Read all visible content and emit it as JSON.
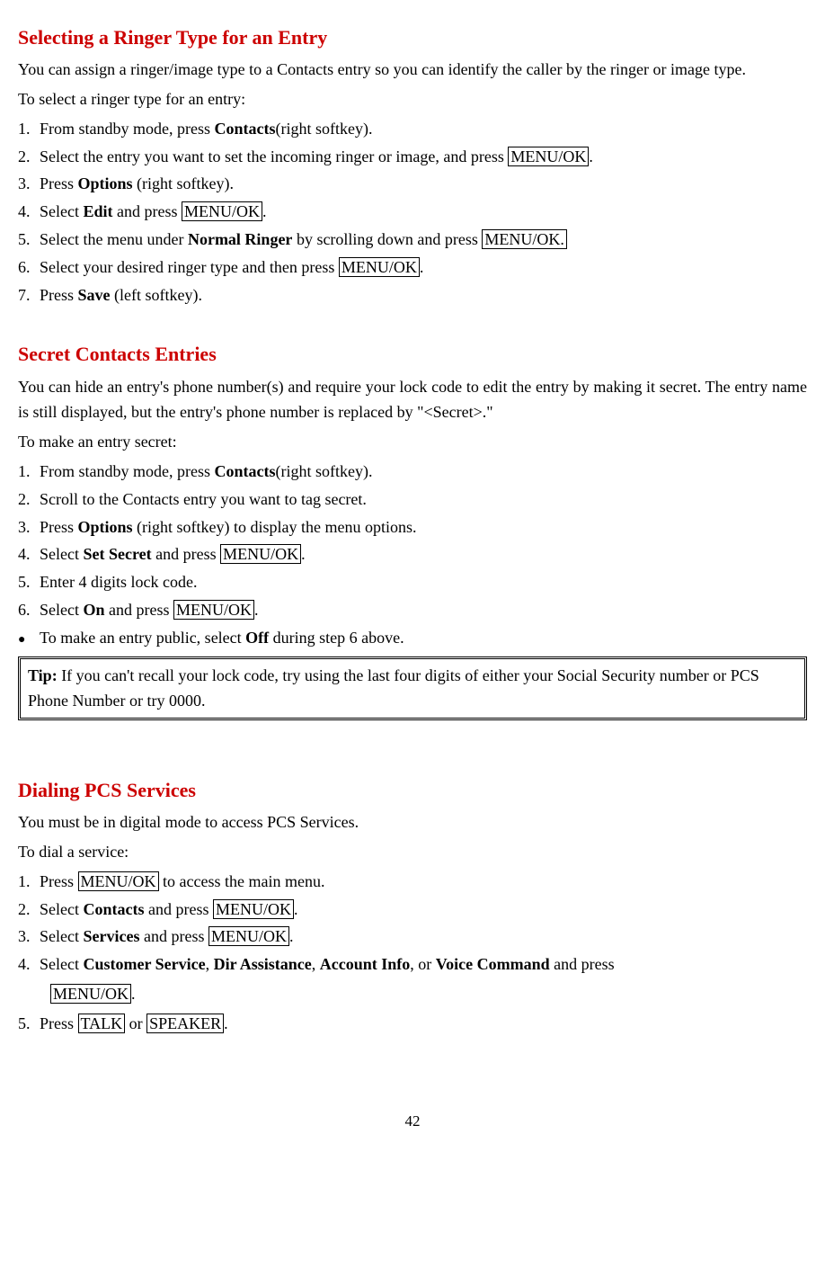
{
  "s1": {
    "title": "Selecting a Ringer Type for an Entry",
    "intro": "You can assign a ringer/image type to a Contacts entry so you can identify the caller by the ringer or image type.",
    "lead": "To select a ringer type for an entry:",
    "steps": {
      "n1": "1.",
      "t1a": "From standby mode, press ",
      "t1b": "Contacts",
      "t1c": "(right softkey).",
      "n2": "2.",
      "t2a": "Select the entry you want to set the incoming ringer or image, and press ",
      "t2b": "MENU/OK",
      "t2c": ".",
      "n3": "3.",
      "t3a": "Press ",
      "t3b": "Options",
      "t3c": " (right softkey).",
      "n4": "4.",
      "t4a": "Select ",
      "t4b": "Edit",
      "t4c": " and press ",
      "t4d": "MENU/OK",
      "t4e": ".",
      "n5": "5.",
      "t5a": "Select the menu under ",
      "t5b": "Normal Ringer",
      "t5c": " by scrolling down and press ",
      "t5d": "MENU/OK.",
      "n6": "6.",
      "t6a": "Select your desired ringer type and then press ",
      "t6b": "MENU/OK",
      "t6c": ".",
      "n7": "7.",
      "t7a": "Press ",
      "t7b": "Save",
      "t7c": " (left softkey)."
    }
  },
  "s2": {
    "title": "Secret Contacts Entries",
    "intro": "You can hide an entry's phone number(s) and require your lock code to edit the entry by making it secret. The entry name is still displayed, but the entry's phone number is replaced by \"<Secret>.\"",
    "lead": "To make an entry secret:",
    "steps": {
      "n1": "1.",
      "t1a": "From standby mode, press ",
      "t1b": "Contacts",
      "t1c": "(right softkey).",
      "n2": "2.",
      "t2a": "Scroll to the Contacts entry you want to tag secret.",
      "n3": "3.",
      "t3a": "Press ",
      "t3b": "Options",
      "t3c": " (right softkey) to display the menu options.",
      "n4": "4.",
      "t4a": "Select ",
      "t4b": "Set Secret",
      "t4c": " and press ",
      "t4d": "MENU/OK",
      "t4e": ".",
      "n5": "5.",
      "t5a": "Enter 4 digits lock code.",
      "n6": "6.",
      "t6a": "Select ",
      "t6b": "On",
      "t6c": " and press ",
      "t6d": "MENU/OK",
      "t6e": ".",
      "bMark": "●",
      "tba": "To make an entry public, select ",
      "tbb": "Off",
      "tbc": " during step 6 above."
    },
    "tip_label": "Tip:",
    "tip_text": " If you can't recall your lock code, try using the last four digits of either your Social Security number or PCS Phone Number or try 0000."
  },
  "s3": {
    "title": "Dialing PCS Services",
    "intro": "You must be in digital mode to access PCS Services.",
    "lead": "To dial a service:",
    "steps": {
      "n1": "1.",
      "t1a": "Press ",
      "t1b": "MENU/OK",
      "t1c": " to access the main menu.",
      "n2": "2.",
      "t2a": "Select ",
      "t2b": "Contacts",
      "t2c": " and press ",
      "t2d": "MENU/OK",
      "t2e": ".",
      "n3": "3.",
      "t3a": "Select ",
      "t3b": "Services",
      "t3c": " and press ",
      "t3d": "MENU/OK",
      "t3e": ".",
      "n4": "4.",
      "t4a": "Select ",
      "t4b": "Customer Service",
      "t4c": ", ",
      "t4d": "Dir Assistance",
      "t4e": ", ",
      "t4f": "Account Info",
      "t4g": ", or ",
      "t4h": "Voice Command",
      "t4i": " and press ",
      "t4j": "MENU/OK",
      "t4k": ".",
      "n5": "5.",
      "t5a": "Press ",
      "t5b": "TALK",
      "t5c": " or ",
      "t5d": "SPEAKER",
      "t5e": "."
    }
  },
  "page": "42"
}
